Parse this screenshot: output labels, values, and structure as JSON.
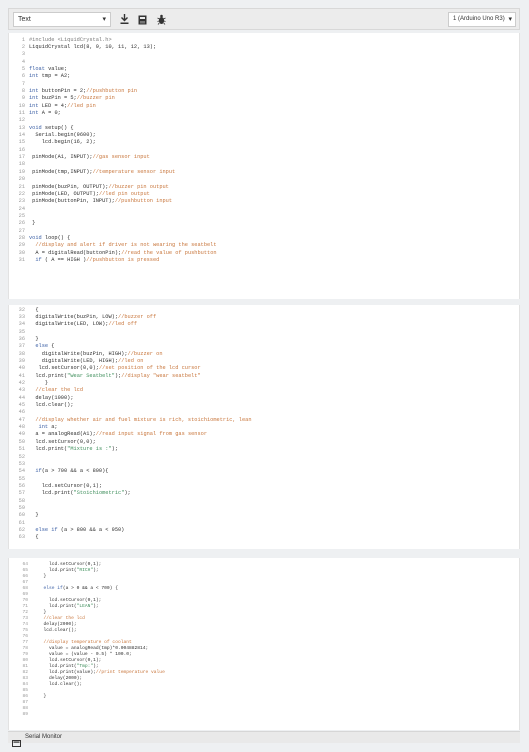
{
  "toolbar": {
    "mode_value": "Text",
    "icons": [
      "download-icon",
      "upload-icon",
      "debug-icon"
    ],
    "board_value": "1 (Arduino Uno R3)"
  },
  "panels": [
    {
      "lines": [
        {
          "n": "1",
          "t": [
            [
              "#include <LiquidCrystal.h>",
              "pp"
            ]
          ]
        },
        {
          "n": "2",
          "t": [
            [
              "LiquidCrystal lcd(8, 9, 10, 11, 12, 13);",
              "tx"
            ]
          ]
        },
        {
          "n": "3",
          "t": []
        },
        {
          "n": "4",
          "t": []
        },
        {
          "n": "5",
          "t": [
            [
              "float",
              "kw"
            ],
            [
              " value;",
              "tx"
            ]
          ]
        },
        {
          "n": "6",
          "t": [
            [
              "int",
              "kw"
            ],
            [
              " tmp = A2;",
              "tx"
            ]
          ]
        },
        {
          "n": "7",
          "t": []
        },
        {
          "n": "8",
          "t": [
            [
              "int",
              "kw"
            ],
            [
              " buttonPin = 2;",
              "tx"
            ],
            [
              "//pushbutton pin",
              "cm"
            ]
          ]
        },
        {
          "n": "9",
          "t": [
            [
              "int",
              "kw"
            ],
            [
              " buzPin = 5;",
              "tx"
            ],
            [
              "//buzzer pin",
              "cm"
            ]
          ]
        },
        {
          "n": "10",
          "t": [
            [
              "int",
              "kw"
            ],
            [
              " LED = 4;",
              "tx"
            ],
            [
              "//led pin",
              "cm"
            ]
          ]
        },
        {
          "n": "11",
          "t": [
            [
              "int",
              "kw"
            ],
            [
              " A = 0;",
              "tx"
            ]
          ]
        },
        {
          "n": "12",
          "t": []
        },
        {
          "n": "13",
          "t": [
            [
              "void",
              "kw"
            ],
            [
              " setup() {",
              "tx"
            ]
          ]
        },
        {
          "n": "14",
          "t": [
            [
              "  Serial.begin(9600);",
              "tx"
            ]
          ]
        },
        {
          "n": "15",
          "t": [
            [
              "    lcd.begin(16, 2);",
              "tx"
            ]
          ]
        },
        {
          "n": "16",
          "t": []
        },
        {
          "n": "17",
          "t": [
            [
              " pinMode(A1, INPUT);",
              "tx"
            ],
            [
              "//gas sensor input",
              "cm"
            ]
          ]
        },
        {
          "n": "18",
          "t": []
        },
        {
          "n": "19",
          "t": [
            [
              " pinMode(tmp,INPUT);",
              "tx"
            ],
            [
              "//temperature sensor input",
              "cm"
            ]
          ]
        },
        {
          "n": "20",
          "t": []
        },
        {
          "n": "21",
          "t": [
            [
              " pinMode(buzPin, OUTPUT);",
              "tx"
            ],
            [
              "//buzzer pin output",
              "cm"
            ]
          ]
        },
        {
          "n": "22",
          "t": [
            [
              " pinMode(LED, OUTPUT);",
              "tx"
            ],
            [
              "//led pin output",
              "cm"
            ]
          ]
        },
        {
          "n": "23",
          "t": [
            [
              " pinMode(buttonPin, INPUT);",
              "tx"
            ],
            [
              "//pushbutton input",
              "cm"
            ]
          ]
        },
        {
          "n": "24",
          "t": []
        },
        {
          "n": "25",
          "t": []
        },
        {
          "n": "26",
          "t": [
            [
              " }",
              "tx"
            ]
          ]
        },
        {
          "n": "27",
          "t": []
        },
        {
          "n": "28",
          "t": [
            [
              "void",
              "kw"
            ],
            [
              " loop() {",
              "tx"
            ]
          ]
        },
        {
          "n": "29",
          "t": [
            [
              "  //display and alert if driver is not wearing the seatbelt",
              "cm"
            ]
          ]
        },
        {
          "n": "30",
          "t": [
            [
              "  A = digitalRead(buttonPin);",
              "tx"
            ],
            [
              "//read the value of pushbutton",
              "cm"
            ]
          ]
        },
        {
          "n": "31",
          "t": [
            [
              "  if",
              "kw"
            ],
            [
              " ( A == HIGH )",
              "tx"
            ],
            [
              "//pushbutton is pressed",
              "cm"
            ]
          ]
        }
      ]
    },
    {
      "lines": [
        {
          "n": "32",
          "t": [
            [
              "  {",
              "tx"
            ]
          ]
        },
        {
          "n": "33",
          "t": [
            [
              "  digitalWrite(buzPin, LOW);",
              "tx"
            ],
            [
              "//buzzer off",
              "cm"
            ]
          ]
        },
        {
          "n": "34",
          "t": [
            [
              "  digitalWrite(LED, LOW);",
              "tx"
            ],
            [
              "//led off",
              "cm"
            ]
          ]
        },
        {
          "n": "35",
          "t": []
        },
        {
          "n": "36",
          "t": [
            [
              "  }",
              "tx"
            ]
          ]
        },
        {
          "n": "37",
          "t": [
            [
              "  else",
              "kw"
            ],
            [
              " {",
              "tx"
            ]
          ]
        },
        {
          "n": "38",
          "t": [
            [
              "    digitalWrite(buzPin, HIGH);",
              "tx"
            ],
            [
              "//buzzer on",
              "cm"
            ]
          ]
        },
        {
          "n": "39",
          "t": [
            [
              "    digitalWrite(LED, HIGH);",
              "tx"
            ],
            [
              "//led on",
              "cm"
            ]
          ]
        },
        {
          "n": "40",
          "t": [
            [
              "   lcd.setCursor(0,0);",
              "tx"
            ],
            [
              "//set position of the lcd cursor",
              "cm"
            ]
          ]
        },
        {
          "n": "41",
          "t": [
            [
              "  lcd.print(",
              "tx"
            ],
            [
              "\"Wear Seatbelt\"",
              "st"
            ],
            [
              ");",
              "tx"
            ],
            [
              "//display \"wear seatbelt\"",
              "cm"
            ]
          ]
        },
        {
          "n": "42",
          "t": [
            [
              "     }",
              "tx"
            ]
          ]
        },
        {
          "n": "43",
          "t": [
            [
              "  //clear the lcd",
              "cm"
            ]
          ]
        },
        {
          "n": "44",
          "t": [
            [
              "  delay(1000);",
              "tx"
            ]
          ]
        },
        {
          "n": "45",
          "t": [
            [
              "  lcd.clear();",
              "tx"
            ]
          ]
        },
        {
          "n": "46",
          "t": []
        },
        {
          "n": "47",
          "t": [
            [
              "  //display whether air and fuel mixture is rich, stoichiometric, lean",
              "cm"
            ]
          ]
        },
        {
          "n": "48",
          "t": [
            [
              "   int",
              "kw"
            ],
            [
              " a;",
              "tx"
            ]
          ]
        },
        {
          "n": "49",
          "t": [
            [
              "  a = analogRead(A1);",
              "tx"
            ],
            [
              "//read input signal from gas sensor",
              "cm"
            ]
          ]
        },
        {
          "n": "50",
          "t": [
            [
              "  lcd.setCursor(0,0);",
              "tx"
            ]
          ]
        },
        {
          "n": "51",
          "t": [
            [
              "  lcd.print(",
              "tx"
            ],
            [
              "\"Mixture is :\"",
              "st"
            ],
            [
              ");",
              "tx"
            ]
          ]
        },
        {
          "n": "52",
          "t": []
        },
        {
          "n": "53",
          "t": []
        },
        {
          "n": "54",
          "t": [
            [
              "  if",
              "kw"
            ],
            [
              "(a > 700 && a < 800){",
              "tx"
            ]
          ]
        },
        {
          "n": "55",
          "t": []
        },
        {
          "n": "56",
          "t": [
            [
              "    lcd.setCursor(0,1);",
              "tx"
            ]
          ]
        },
        {
          "n": "57",
          "t": [
            [
              "    lcd.print(",
              "tx"
            ],
            [
              "\"Stoichiometric\"",
              "st"
            ],
            [
              ");",
              "tx"
            ]
          ]
        },
        {
          "n": "58",
          "t": []
        },
        {
          "n": "59",
          "t": []
        },
        {
          "n": "60",
          "t": [
            [
              "  }",
              "tx"
            ]
          ]
        },
        {
          "n": "61",
          "t": []
        },
        {
          "n": "62",
          "t": [
            [
              "  else if",
              "kw"
            ],
            [
              " (a > 800 && a < 950)",
              "tx"
            ]
          ]
        },
        {
          "n": "63",
          "t": [
            [
              "  {",
              "tx"
            ]
          ]
        }
      ]
    },
    {
      "lines": [
        {
          "n": "64",
          "t": [
            [
              "    lcd.setCursor(0,1);",
              "tx"
            ]
          ]
        },
        {
          "n": "65",
          "t": [
            [
              "    lcd.print(",
              "tx"
            ],
            [
              "\"RICH\"",
              "st"
            ],
            [
              ");",
              "tx"
            ]
          ]
        },
        {
          "n": "66",
          "t": [
            [
              "  }",
              "tx"
            ]
          ]
        },
        {
          "n": "67",
          "t": []
        },
        {
          "n": "68",
          "t": [
            [
              "  else if",
              "kw"
            ],
            [
              "(a > 0 && a < 700) {",
              "tx"
            ]
          ]
        },
        {
          "n": "69",
          "t": []
        },
        {
          "n": "70",
          "t": [
            [
              "    lcd.setCursor(0,1);",
              "tx"
            ]
          ]
        },
        {
          "n": "71",
          "t": [
            [
              "    lcd.print(",
              "tx"
            ],
            [
              "\"LEAN\"",
              "st"
            ],
            [
              ");",
              "tx"
            ]
          ]
        },
        {
          "n": "72",
          "t": [
            [
              "  }",
              "tx"
            ]
          ]
        },
        {
          "n": "73",
          "t": [
            [
              "  //clear the lcd",
              "cm"
            ]
          ]
        },
        {
          "n": "74",
          "t": [
            [
              "  delay(2000);",
              "tx"
            ]
          ]
        },
        {
          "n": "75",
          "t": [
            [
              "  lcd.clear();",
              "tx"
            ]
          ]
        },
        {
          "n": "76",
          "t": []
        },
        {
          "n": "77",
          "t": [
            [
              "  //display temperature of coolant",
              "cm"
            ]
          ]
        },
        {
          "n": "78",
          "t": [
            [
              "    value = analogRead(tmp)*0.004882814;",
              "tx"
            ]
          ]
        },
        {
          "n": "79",
          "t": [
            [
              "    value = (value - 0.5) * 100.0;",
              "tx"
            ]
          ]
        },
        {
          "n": "80",
          "t": [
            [
              "    lcd.setCursor(0,1);",
              "tx"
            ]
          ]
        },
        {
          "n": "81",
          "t": [
            [
              "    lcd.print(",
              "tx"
            ],
            [
              "\"Tmp:\"",
              "st"
            ],
            [
              ");",
              "tx"
            ]
          ]
        },
        {
          "n": "82",
          "t": [
            [
              "    lcd.print(value);",
              "tx"
            ],
            [
              "//print temperature value",
              "cm"
            ]
          ]
        },
        {
          "n": "83",
          "t": [
            [
              "    delay(2000);",
              "tx"
            ]
          ]
        },
        {
          "n": "84",
          "t": [
            [
              "    lcd.clear();",
              "tx"
            ]
          ]
        },
        {
          "n": "85",
          "t": []
        },
        {
          "n": "86",
          "t": [
            [
              "  }",
              "tx"
            ]
          ]
        },
        {
          "n": "87",
          "t": []
        },
        {
          "n": "88",
          "t": []
        },
        {
          "n": "89",
          "t": []
        }
      ]
    }
  ],
  "statusbar": {
    "serial_monitor_label": "Serial Monitor",
    "icon": "serial-monitor-icon"
  },
  "colors": {
    "comment": "#c8763c",
    "keyword": "#3b5fa5",
    "string": "#3f8f5c",
    "text": "#303030",
    "line_number": "#9a9a9a"
  }
}
